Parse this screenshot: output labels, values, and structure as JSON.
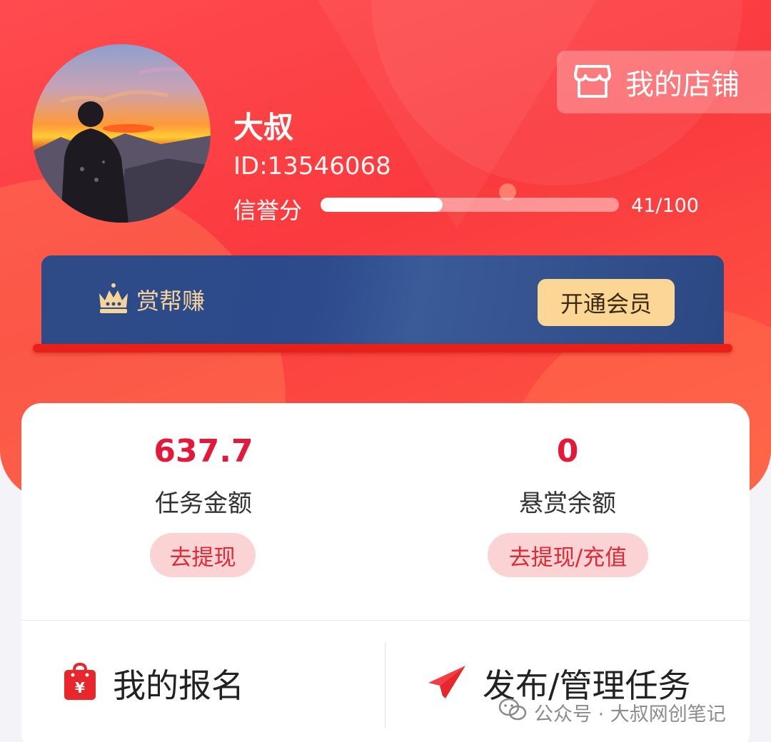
{
  "profile": {
    "name": "大叔",
    "id_text": "ID:13546068",
    "credit_label": "信誉分",
    "credit_value_text": "41/100",
    "credit_fraction": 0.41
  },
  "shop_button": {
    "label": "我的店铺",
    "icon": "store-icon"
  },
  "vip": {
    "brand": "赏帮赚",
    "brand_icon": "crown-icon",
    "cta": "开通会员"
  },
  "balances": [
    {
      "value": "637.7",
      "label": "任务金额",
      "action": "去提现"
    },
    {
      "value": "0",
      "label": "悬赏余额",
      "action": "去提现/充值"
    }
  ],
  "actions": [
    {
      "label": "我的报名",
      "icon": "shopping-bag-yen-icon"
    },
    {
      "label": "发布/管理任务",
      "icon": "paper-plane-icon"
    }
  ],
  "watermark": {
    "text": "公众号 · 大叔网创笔记",
    "icon": "wechat-icon"
  },
  "colors": {
    "header_red": "#fa3a3e",
    "accent_red": "#e6183a",
    "vip_blue": "#2e4b86",
    "vip_gold": "#fbd694",
    "pill_pink": "#fbd3d5"
  }
}
